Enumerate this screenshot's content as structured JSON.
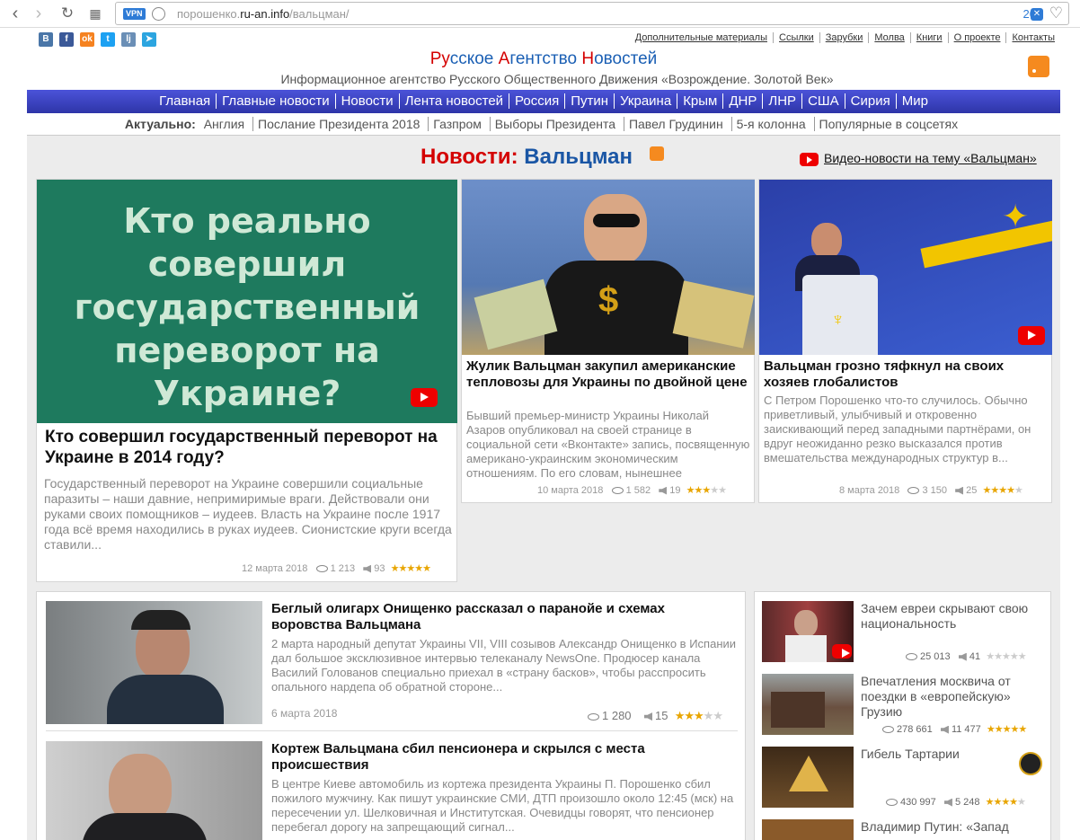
{
  "browser": {
    "vpn_label": "VPN",
    "url_prefix": "порошенко.",
    "url_domain": "ru-an.info",
    "url_path": "/вальцман/",
    "badge_count": "20"
  },
  "header": {
    "social": [
      {
        "icon": "vk-icon",
        "letter": "B",
        "color": "#4a76a8"
      },
      {
        "icon": "facebook-icon",
        "letter": "f",
        "color": "#3b5998"
      },
      {
        "icon": "odnoklassniki-icon",
        "letter": "ok",
        "color": "#f58220"
      },
      {
        "icon": "twitter-icon",
        "letter": "t",
        "color": "#1da1f2"
      },
      {
        "icon": "livejournal-icon",
        "letter": "lj",
        "color": "#6b8fb6"
      },
      {
        "icon": "telegram-icon",
        "letter": "➤",
        "color": "#2ca5e0"
      }
    ],
    "toplinks": [
      "Дополнительные материалы",
      "Ссылки",
      "Зарубки",
      "Молва",
      "Книги",
      "О проекте",
      "Контакты"
    ],
    "logo": {
      "r1": "Ру",
      "t1": "сское ",
      "r2": "А",
      "t2": "гентство ",
      "r3": "Н",
      "t3": "овостей"
    },
    "tagline": "Информационное агентство Русского Общественного Движения «Возрождение. Золотой Век»"
  },
  "menu": [
    "Главная",
    "Главные новости",
    "Новости",
    "Лента новостей",
    "Россия",
    "Путин",
    "Украина",
    "Крым",
    "ДНР",
    "ЛНР",
    "США",
    "Сирия",
    "Мир"
  ],
  "actual": {
    "label": "Актуально:",
    "items": [
      "Англия",
      "Послание Президента 2018",
      "Газпром",
      "Выборы Президента",
      "Павел Грудинин",
      "5-я колонна",
      "Популярные в соцсетях"
    ]
  },
  "section": {
    "title_prefix": "Новости:",
    "title_name": "Вальцман",
    "video_link": "Видео-новости на тему «Вальцман»"
  },
  "main_story": {
    "image_text": "Кто реально совершил государственный переворот на Украине?",
    "title": "Кто совершил государственный переворот на Украине в 2014 году?",
    "text": "Государственный переворот на Украине совершили социальные паразиты – наши давние, непримиримые враги. Действовали они руками своих помощников – иудеев. Власть на Украине после 1917 года всё время находились в руках иудеев. Сионистские круги всегда ставили...",
    "date": "12 марта 2018",
    "views": "1 213",
    "comments": "93",
    "rating": 5
  },
  "story2": {
    "title": "Жулик Вальцман закупил американские тепловозы для Украины по двойной цене",
    "text": "Бывший премьер-министр Украины Николай Азаров опубликовал на своей странице в социальной сети «Вконтакте» запись, посвященную американо-украинским экономическим отношениям. По его словам, нынешнее",
    "date": "10 марта 2018",
    "views": "1 582",
    "comments": "19",
    "rating": 3
  },
  "story3": {
    "title": "Вальцман грозно тяфкнул на своих хозяев глобалистов",
    "text": "С Петром Порошенко что-то случилось. Обычно приветливый, улыбчивый и откровенно заискивающий перед западными партнёрами, он вдруг неожиданно резко высказался против вмешательства международных структур в...",
    "date": "8 марта 2018",
    "views": "3 150",
    "comments": "25",
    "rating": 4
  },
  "list": [
    {
      "title": "Беглый олигарх Онищенко рассказал о паранойе и схемах воровства Вальцмана",
      "text": "2 марта народный депутат Украины VII, VIII созывов Александр Онищенко в Испании дал большое эксклюзивное интервью телеканалу NewsOne. Продюсер канала Василий Голованов специально приехал в «страну басков», чтобы расспросить опального нардепа об обратной стороне...",
      "date": "6 марта 2018",
      "views": "1 280",
      "comments": "15",
      "rating": 3
    },
    {
      "title": "Кортеж Вальцмана сбил пенсионера и скрылся с места происшествия",
      "text": "В центре Киеве автомобиль из кортежа президента Украины П. Порошенко сбил пожилого мужчину. Как пишут украинские СМИ, ДТП произошло около 12:45 (мск) на пересечении ул. Шелковичная и Институтская. Очевидцы говорят, что пенсионер перебегал дорогу на запрещающий сигнал..."
    }
  ],
  "sidebar": [
    {
      "title": "Зачем евреи скрывают свою национальность",
      "views": "25 013",
      "comments": "41",
      "rating": 0
    },
    {
      "title": "Впечатления москвича от поездки в «европейскую» Грузию",
      "views": "278 661",
      "comments": "11 477",
      "rating": 5
    },
    {
      "title": "Гибель Тартарии",
      "views": "430 997",
      "comments": "5 248",
      "rating": 4
    },
    {
      "title": "Владимир Путин: «Запад"
    }
  ]
}
